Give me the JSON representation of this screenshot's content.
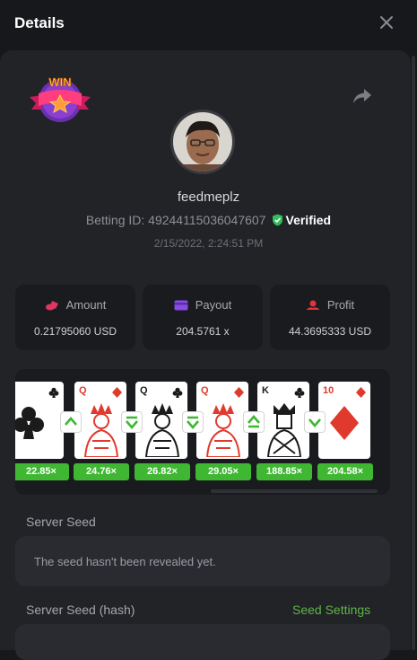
{
  "header": {
    "title": "Details"
  },
  "win_badge": {
    "text": "WIN"
  },
  "profile": {
    "username": "feedmeplz",
    "betting_id_label": "Betting ID: 49244115036047607",
    "verified_label": "Verified",
    "date": "2/15/2022, 2:24:51 PM"
  },
  "stats": {
    "amount": {
      "label": "Amount",
      "value": "0.21795060 USD"
    },
    "payout": {
      "label": "Payout",
      "value": "204.5761 x"
    },
    "profit": {
      "label": "Profit",
      "value": "44.3695333 USD"
    }
  },
  "cards": [
    {
      "rank": "",
      "suit": "club",
      "multiplier": "22.85×"
    },
    {
      "rank": "Q",
      "suit": "diamond",
      "multiplier": "24.76×"
    },
    {
      "rank": "Q",
      "suit": "club",
      "multiplier": "26.82×"
    },
    {
      "rank": "Q",
      "suit": "diamond",
      "multiplier": "29.05×"
    },
    {
      "rank": "K",
      "suit": "club",
      "multiplier": "188.85×"
    },
    {
      "rank": "10",
      "suit": "diamond",
      "multiplier": "204.58×"
    }
  ],
  "guesses": [
    "higher",
    "lower",
    "lower",
    "higher-or-same",
    "lower"
  ],
  "server_seed": {
    "label": "Server Seed",
    "placeholder": "The seed hasn't been revealed yet."
  },
  "server_seed_hash": {
    "label": "Server Seed (hash)",
    "settings_link": "Seed Settings"
  },
  "colors": {
    "accent_green": "#3fb732",
    "link_green": "#5db548",
    "verified_green": "#2ec15a",
    "red_suit": "#e03a2e",
    "panel": "#222327"
  },
  "icons": {
    "close": "close-icon",
    "share": "share-icon",
    "verified": "shield-check-icon",
    "amount": "coins-icon",
    "payout": "wallet-icon",
    "profit": "profit-icon"
  }
}
